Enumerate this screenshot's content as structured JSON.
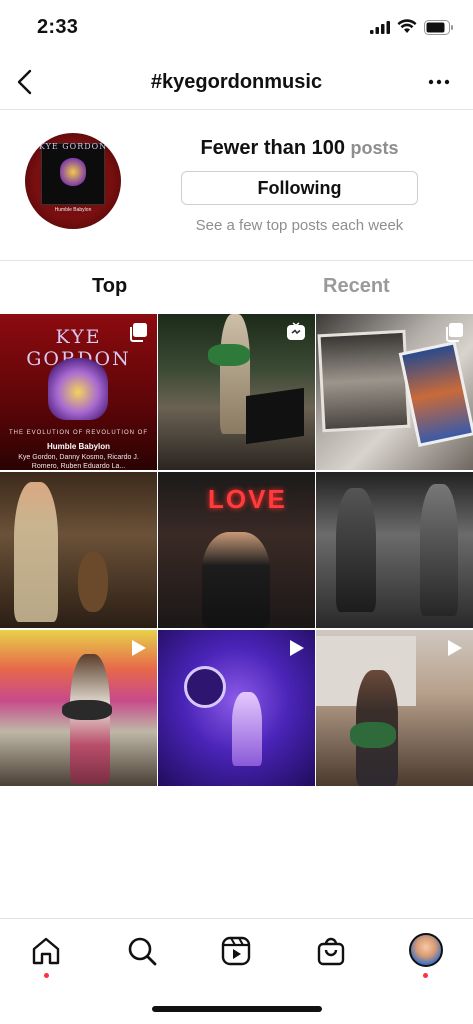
{
  "status": {
    "time": "2:33"
  },
  "header": {
    "title": "#kyegordonmusic"
  },
  "hashtag": {
    "posts_count": "Fewer than 100",
    "posts_label": "posts",
    "follow_label": "Following",
    "hint": "See a few top posts each week",
    "avatar_text": "KYE GORDON",
    "avatar_caption": "Humble Babylon"
  },
  "tabs": {
    "top": "Top",
    "recent": "Recent",
    "active": "Top"
  },
  "grid": {
    "first_post": {
      "logo": "KYE GORDON",
      "subtitle": "THE EVOLUTION OF REVOLUTION OF",
      "name": "Humble Babylon",
      "credit": "Kye Gordon, Danny Kosmo, Ricardo J. Romero, Ruben Eduardo La..."
    },
    "neon_sign": "LOVE",
    "badges": [
      "multi",
      "none",
      "multi",
      "none",
      "none",
      "none",
      "reel",
      "reel",
      "reel"
    ]
  },
  "colors": {
    "accent_dot": "#ff3040",
    "inactive_tab": "#9a9a9a"
  },
  "nav": {
    "items": [
      "home-icon",
      "search-icon",
      "reels-icon",
      "shop-icon",
      "profile-avatar"
    ]
  }
}
